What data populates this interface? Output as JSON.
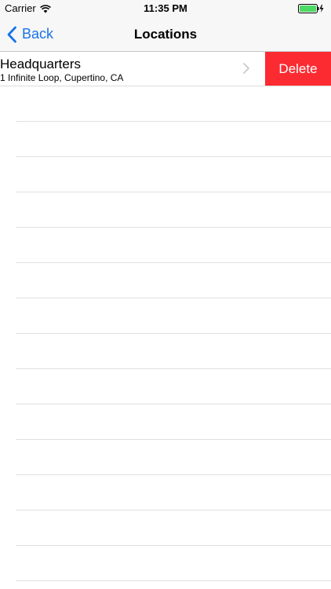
{
  "status_bar": {
    "carrier": "Carrier",
    "time": "11:35 PM"
  },
  "nav": {
    "back_label": "Back",
    "title": "Locations"
  },
  "rows": [
    {
      "title": "Headquarters",
      "subtitle": "1 Infinite Loop, Cupertino, CA",
      "delete_label": "Delete"
    }
  ],
  "colors": {
    "accent": "#1a73e8",
    "delete": "#fc2b32",
    "battery": "#4cd964"
  }
}
